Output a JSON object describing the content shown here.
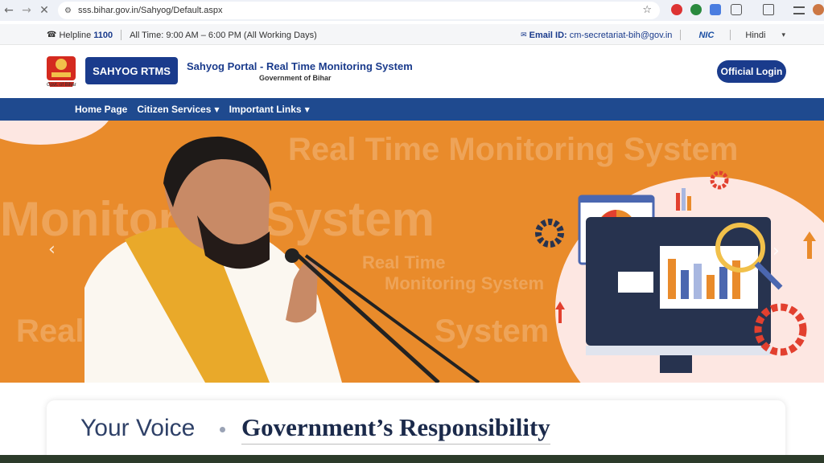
{
  "browser": {
    "url": "sss.bihar.gov.in/Sahyog/Default.aspx",
    "back_icon": "back-arrow-icon",
    "forward_icon": "forward-arrow-icon",
    "stop_icon": "close-icon"
  },
  "infobar": {
    "helpline_label": "Helpline",
    "helpline_number": "1100",
    "hours": "All Time: 9:00 AM – 6:00 PM (All Working Days)",
    "email_label": "Email ID:",
    "email_value": "cm-secretariat-bih@gov.in",
    "nic": "NIC",
    "language": "Hindi"
  },
  "header": {
    "emblem_text": "Govt. of Bihar",
    "badge": "SAHYOG RTMS",
    "title": "Sahyog Portal - Real Time Monitoring System",
    "subtitle": "Government of Bihar",
    "login": "Official Login"
  },
  "nav": {
    "items": [
      {
        "label": "Home Page"
      },
      {
        "label": "Citizen Services"
      },
      {
        "label": "Important Links"
      }
    ]
  },
  "banner": {
    "wm1": "Real Time Monitoring System",
    "wm2": "Monitoring System",
    "wm3": "Real Time",
    "wm4": "Monitoring System",
    "wm5": "Real",
    "wm6": "System"
  },
  "section": {
    "voice": "Your Voice",
    "responsibility": "Government’s Responsibility"
  },
  "colors": {
    "primary": "#1a3b8c",
    "navbar": "#1f4a8f",
    "banner": "#e98b2b"
  }
}
